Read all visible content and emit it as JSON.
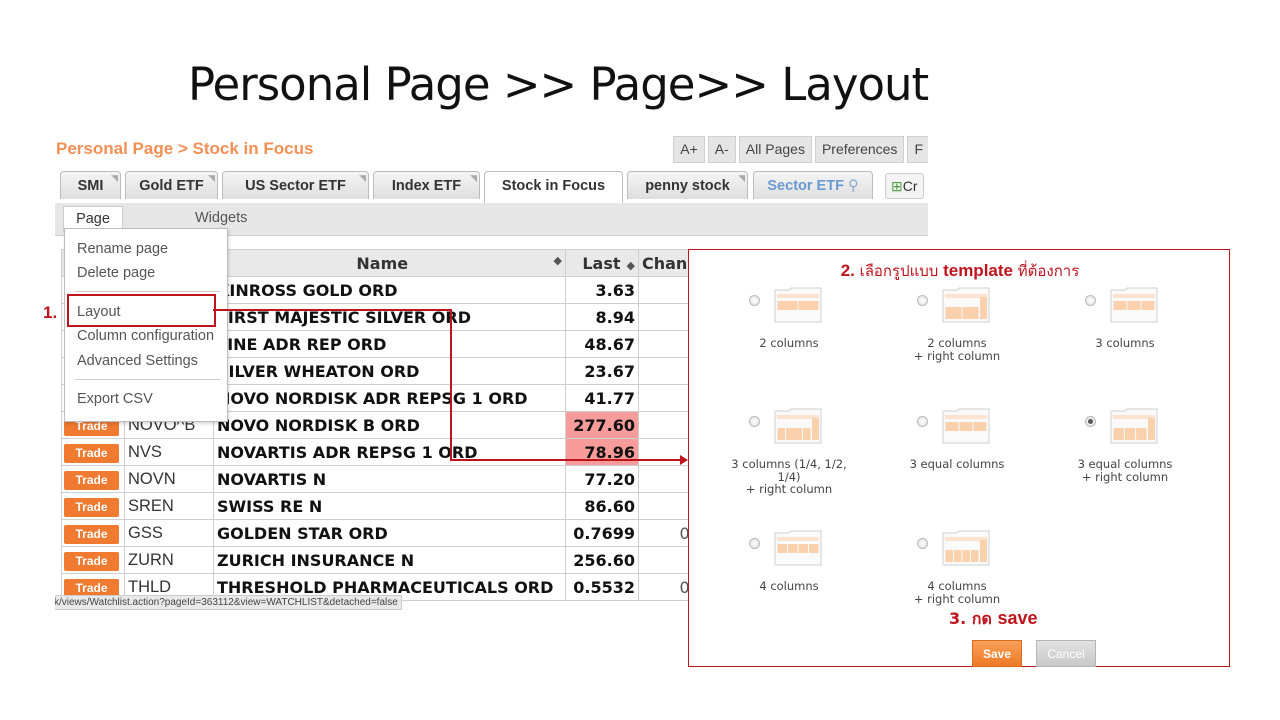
{
  "slide_title": "Personal Page >> Page>> Layout",
  "breadcrumb": "Personal Page  >  Stock in Focus",
  "toolbar": [
    "A+",
    "A-",
    "All Pages",
    "Preferences",
    "F"
  ],
  "tabs": [
    {
      "label": "SMI"
    },
    {
      "label": "Gold ETF"
    },
    {
      "label": "US Sector ETF"
    },
    {
      "label": "Index ETF"
    },
    {
      "label": "Stock in Focus"
    },
    {
      "label": "penny stock"
    },
    {
      "label": "Sector ETF"
    }
  ],
  "create_tab_label": "Cr",
  "subtabs": {
    "page": "Page",
    "widgets": "Widgets"
  },
  "menu": {
    "rename": "Rename page",
    "delete": "Delete page",
    "layout": "Layout",
    "column_config": "Column configuration",
    "advanced": "Advanced Settings",
    "export": "Export CSV"
  },
  "table": {
    "headers": {
      "name": "Name",
      "last": "Last",
      "change": "Chan"
    },
    "trade_label": "Trade",
    "rows": [
      {
        "sym": "",
        "name": "KINROSS GOLD ORD",
        "last": "3.63",
        "chg": "",
        "hl": false
      },
      {
        "sym": "",
        "name": "FIRST MAJESTIC SILVER ORD",
        "last": "8.94",
        "chg": "",
        "hl": false
      },
      {
        "sym": "",
        "name": "LINE ADR REP ORD",
        "last": "48.67",
        "chg": "",
        "hl": false
      },
      {
        "sym": "",
        "name": "SILVER WHEATON ORD",
        "last": "23.67",
        "chg": "",
        "hl": false
      },
      {
        "sym": "",
        "name": "NOVO NORDISK ADR REPSG 1 ORD",
        "last": "41.77",
        "chg": "",
        "hl": false
      },
      {
        "sym": "NOVO^B",
        "name": "NOVO NORDISK B ORD",
        "last": "277.60",
        "chg": "",
        "hl": true
      },
      {
        "sym": "NVS",
        "name": "NOVARTIS ADR REPSG 1 ORD",
        "last": "78.96",
        "chg": "",
        "hl": true
      },
      {
        "sym": "NOVN",
        "name": "NOVARTIS N",
        "last": "77.20",
        "chg": "-",
        "hl": false
      },
      {
        "sym": "SREN",
        "name": "SWISS RE N",
        "last": "86.60",
        "chg": "",
        "hl": false
      },
      {
        "sym": "GSS",
        "name": "GOLDEN STAR ORD",
        "last": "0.7699",
        "chg": "0.0",
        "hl": false
      },
      {
        "sym": "ZURN",
        "name": "ZURICH INSURANCE N",
        "last": "256.60",
        "chg": "",
        "hl": false
      },
      {
        "sym": "THLD",
        "name": "THRESHOLD PHARMACEUTICALS ORD",
        "last": "0.5532",
        "chg": "0.0",
        "hl": false
      }
    ]
  },
  "status_url": "k/views/Watchlist.action?pageId=363112&view=WATCHLIST&detached=false",
  "step1": "1.",
  "step2_num": "2. ",
  "step2_text": "เลือกรูปแบบ ",
  "step2_bold": "template",
  "step2_tail": " ที่ต้องการ",
  "step3_num": "3. กด ",
  "step3_bold": "save",
  "layouts": [
    {
      "label": "2 columns",
      "label2": "",
      "label3": "",
      "selected": false
    },
    {
      "label": "2 columns",
      "label2": "+ right column",
      "label3": "",
      "selected": false
    },
    {
      "label": "3 columns",
      "label2": "",
      "label3": "",
      "selected": false
    },
    {
      "label": "3 columns (1/4, 1/2,",
      "label2": "1/4)",
      "label3": "+ right column",
      "selected": false
    },
    {
      "label": "3 equal columns",
      "label2": "",
      "label3": "",
      "selected": false
    },
    {
      "label": "3 equal columns",
      "label2": "+ right column",
      "label3": "",
      "selected": true
    },
    {
      "label": "4 columns",
      "label2": "",
      "label3": "",
      "selected": false
    },
    {
      "label": "4 columns",
      "label2": "+ right column",
      "label3": "",
      "selected": false
    }
  ],
  "buttons": {
    "save": "Save",
    "cancel": "Cancel"
  },
  "colors": {
    "accent": "#f07a2f",
    "annotation": "#c0141d",
    "highlight": "#f79b9b",
    "breadcrumb": "#f29055"
  }
}
